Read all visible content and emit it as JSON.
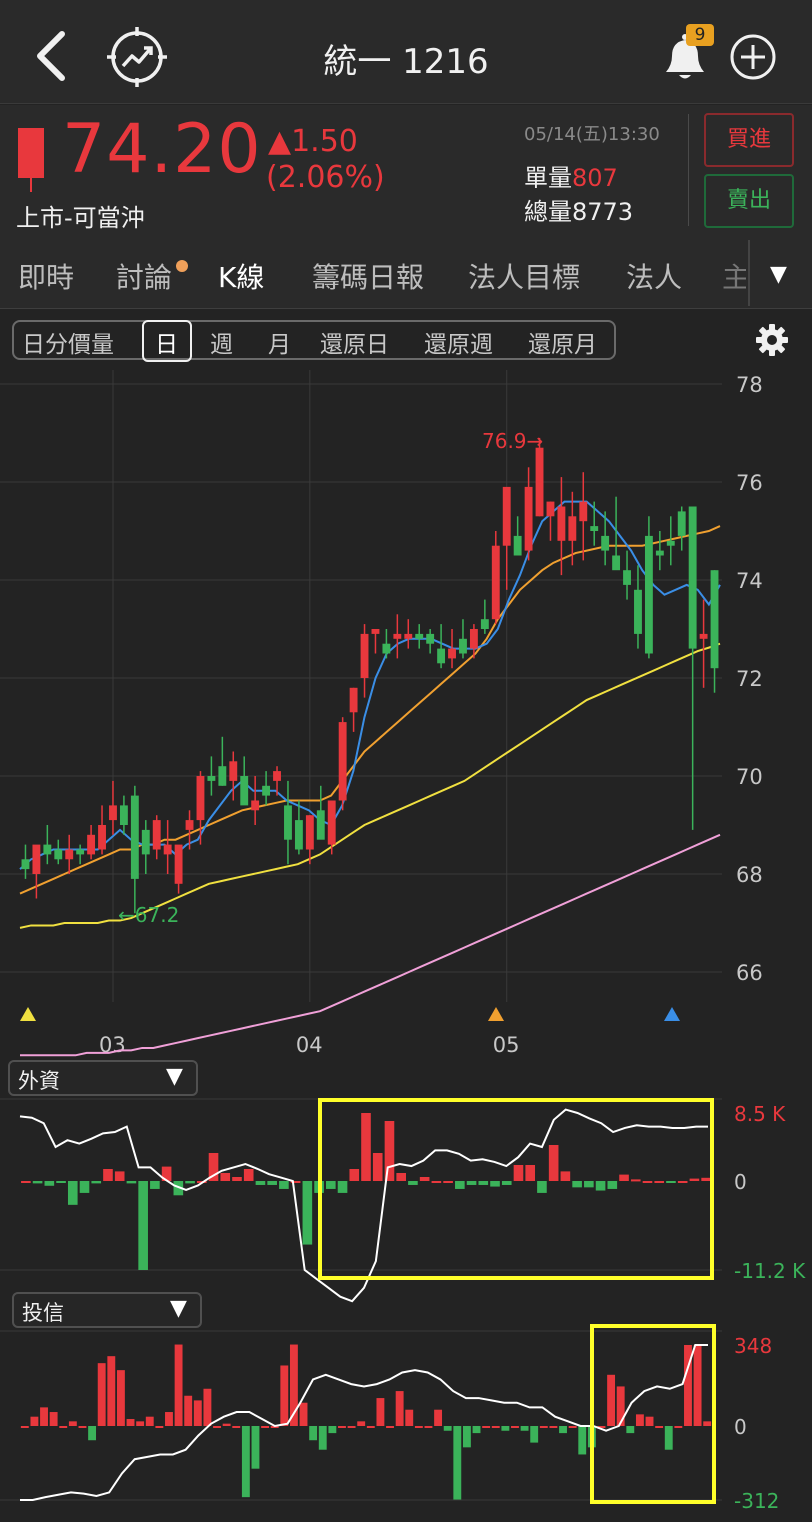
{
  "header": {
    "title": "統一 1216",
    "notification_count": "9",
    "back_icon": "chevron-left-icon",
    "trend_icon": "target-trend-icon",
    "bell_icon": "bell-icon",
    "add_icon": "plus-circle-icon"
  },
  "quote": {
    "price": "74.20",
    "change": "▲1.50",
    "change_pct": "(2.06%)",
    "market": "上市-可當沖",
    "datetime": "05/14(五)13:30",
    "single_vol_label": "單量",
    "single_vol": "807",
    "total_vol_label": "總量",
    "total_vol": "8773",
    "buy_label": "買進",
    "sell_label": "賣出"
  },
  "tabs": [
    "即時",
    "討論",
    "K線",
    "籌碼日報",
    "法人目標",
    "法人",
    "主"
  ],
  "active_tab": "K線",
  "periods": [
    "日分價量",
    "日",
    "週",
    "月",
    "還原日",
    "還原週",
    "還原月"
  ],
  "active_period": "日",
  "colors": {
    "up": "#e8383d",
    "down": "#3bb35a",
    "ma5": "#3a8ee6",
    "ma10": "#f0a030",
    "ma20": "#f0e040",
    "ma60": "#f0a0d8",
    "highlight": "#ffff2a"
  },
  "chart_data": [
    {
      "type": "candlestick",
      "yticks": [
        "78",
        "76",
        "74",
        "72",
        "70",
        "68",
        "66"
      ],
      "ylim": [
        65,
        79
      ],
      "xticks": [
        "03",
        "04",
        "05"
      ],
      "annotations": {
        "high": "76.9→",
        "low": "←67.2"
      },
      "ohlc": [
        [
          68.3,
          68.6,
          67.9,
          68.1
        ],
        [
          68.0,
          68.5,
          67.5,
          68.6
        ],
        [
          68.6,
          69.0,
          68.2,
          68.4
        ],
        [
          68.5,
          68.7,
          68.2,
          68.3
        ],
        [
          68.3,
          68.8,
          68.0,
          68.5
        ],
        [
          68.5,
          68.6,
          68.2,
          68.4
        ],
        [
          68.4,
          69.0,
          68.3,
          68.8
        ],
        [
          68.5,
          69.4,
          68.4,
          69.0
        ],
        [
          69.1,
          69.9,
          68.8,
          69.4
        ],
        [
          69.4,
          69.6,
          68.8,
          69.0
        ],
        [
          69.6,
          69.8,
          67.2,
          67.9
        ],
        [
          68.9,
          69.1,
          68.0,
          68.4
        ],
        [
          68.5,
          69.2,
          68.3,
          69.1
        ],
        [
          68.4,
          69.1,
          68.0,
          68.6
        ],
        [
          67.8,
          68.5,
          67.6,
          68.6
        ],
        [
          68.9,
          69.3,
          68.5,
          69.1
        ],
        [
          69.1,
          70.1,
          68.6,
          70.0
        ],
        [
          70.0,
          70.4,
          69.6,
          69.9
        ],
        [
          70.2,
          70.8,
          69.8,
          69.8
        ],
        [
          69.9,
          70.5,
          69.5,
          70.3
        ],
        [
          70.0,
          70.4,
          69.5,
          69.4
        ],
        [
          69.3,
          70.0,
          69.0,
          69.5
        ],
        [
          69.8,
          70.1,
          69.4,
          69.6
        ],
        [
          69.9,
          70.2,
          69.6,
          70.1
        ],
        [
          69.4,
          69.9,
          68.2,
          68.7
        ],
        [
          69.1,
          69.5,
          68.4,
          68.5
        ],
        [
          68.5,
          69.2,
          68.2,
          69.2
        ],
        [
          69.3,
          69.8,
          68.8,
          68.7
        ],
        [
          68.6,
          69.3,
          68.4,
          69.5
        ],
        [
          69.5,
          71.2,
          69.3,
          71.1
        ],
        [
          71.3,
          71.8,
          70.9,
          71.8
        ],
        [
          72.0,
          73.1,
          71.6,
          72.9
        ],
        [
          72.9,
          73.0,
          72.5,
          73.0
        ],
        [
          72.7,
          73.0,
          72.4,
          72.5
        ],
        [
          72.8,
          73.3,
          72.4,
          72.9
        ],
        [
          72.8,
          73.2,
          72.6,
          72.9
        ],
        [
          72.9,
          73.1,
          72.6,
          72.8
        ],
        [
          72.9,
          73.0,
          72.5,
          72.7
        ],
        [
          72.6,
          73.1,
          72.2,
          72.3
        ],
        [
          72.4,
          73.0,
          72.2,
          72.6
        ],
        [
          72.8,
          73.2,
          72.4,
          72.5
        ],
        [
          72.6,
          73.1,
          72.4,
          73.0
        ],
        [
          73.2,
          73.6,
          72.9,
          73.0
        ],
        [
          73.2,
          75.0,
          73.1,
          74.7
        ],
        [
          74.7,
          75.8,
          73.8,
          75.9
        ],
        [
          74.9,
          75.3,
          74.5,
          74.5
        ],
        [
          74.6,
          76.3,
          74.4,
          75.9
        ],
        [
          75.3,
          76.9,
          75.3,
          76.7
        ],
        [
          75.3,
          75.6,
          74.8,
          75.6
        ],
        [
          74.8,
          76.1,
          74.1,
          75.5
        ],
        [
          74.8,
          75.8,
          74.3,
          75.3
        ],
        [
          75.2,
          76.2,
          74.4,
          75.6
        ],
        [
          75.1,
          75.6,
          74.7,
          75.0
        ],
        [
          74.9,
          75.4,
          74.3,
          74.6
        ],
        [
          74.5,
          75.7,
          74.3,
          74.2
        ],
        [
          74.2,
          74.6,
          73.6,
          73.9
        ],
        [
          73.8,
          74.3,
          72.6,
          72.9
        ],
        [
          74.9,
          75.3,
          72.4,
          72.5
        ],
        [
          74.6,
          75.0,
          74.2,
          74.5
        ],
        [
          74.8,
          75.3,
          74.3,
          74.7
        ],
        [
          75.4,
          75.5,
          74.6,
          74.9
        ],
        [
          75.5,
          75.5,
          68.9,
          72.6
        ],
        [
          72.8,
          73.6,
          71.8,
          72.9
        ],
        [
          74.2,
          74.2,
          71.7,
          72.2
        ]
      ],
      "ma5": [
        68.1,
        68.3,
        68.4,
        68.5,
        68.5,
        68.5,
        68.5,
        68.5,
        68.7,
        68.9,
        68.7,
        68.6,
        68.6,
        68.6,
        68.4,
        68.6,
        68.7,
        69.1,
        69.4,
        69.7,
        69.9,
        69.7,
        69.7,
        69.7,
        69.5,
        69.4,
        69.3,
        69.1,
        69.0,
        69.4,
        70.1,
        71.2,
        72.0,
        72.5,
        72.7,
        72.8,
        72.8,
        72.8,
        72.7,
        72.6,
        72.6,
        72.6,
        72.7,
        73.0,
        73.6,
        74.1,
        74.7,
        75.2,
        75.4,
        75.6,
        75.6,
        75.6,
        75.4,
        75.2,
        74.9,
        74.6,
        74.2,
        73.9,
        73.7,
        73.8,
        73.9,
        73.8,
        73.5,
        73.9
      ],
      "ma10": [
        67.6,
        67.7,
        67.8,
        67.9,
        68.0,
        68.1,
        68.2,
        68.3,
        68.4,
        68.5,
        68.5,
        68.6,
        68.6,
        68.7,
        68.7,
        68.8,
        68.9,
        69.0,
        69.1,
        69.2,
        69.3,
        69.35,
        69.4,
        69.45,
        69.5,
        69.5,
        69.5,
        69.5,
        69.6,
        69.9,
        70.2,
        70.5,
        70.7,
        70.9,
        71.1,
        71.3,
        71.5,
        71.7,
        71.9,
        72.1,
        72.3,
        72.5,
        72.8,
        73.2,
        73.5,
        73.8,
        74.0,
        74.2,
        74.35,
        74.45,
        74.55,
        74.6,
        74.65,
        74.7,
        74.7,
        74.7,
        74.7,
        74.75,
        74.8,
        74.85,
        74.9,
        74.95,
        75.0,
        75.1
      ],
      "ma20": [
        66.9,
        66.95,
        66.95,
        66.95,
        67.0,
        67.0,
        67.0,
        67.0,
        67.05,
        67.05,
        67.1,
        67.2,
        67.3,
        67.4,
        67.5,
        67.6,
        67.7,
        67.8,
        67.85,
        67.9,
        67.95,
        68.0,
        68.05,
        68.1,
        68.15,
        68.2,
        68.3,
        68.4,
        68.55,
        68.7,
        68.85,
        69.0,
        69.1,
        69.2,
        69.3,
        69.4,
        69.5,
        69.6,
        69.7,
        69.8,
        69.9,
        70.05,
        70.2,
        70.35,
        70.5,
        70.65,
        70.8,
        70.95,
        71.1,
        71.25,
        71.4,
        71.55,
        71.65,
        71.75,
        71.85,
        71.95,
        72.05,
        72.15,
        72.25,
        72.35,
        72.45,
        72.55,
        72.62,
        72.7
      ],
      "ma60": [
        64.3,
        64.3,
        64.3,
        64.3,
        64.3,
        64.3,
        64.35,
        64.35,
        64.35,
        64.4,
        64.4,
        64.45,
        64.45,
        64.5,
        64.55,
        64.6,
        64.65,
        64.7,
        64.75,
        64.8,
        64.85,
        64.9,
        64.95,
        65.0,
        65.05,
        65.1,
        65.15,
        65.2,
        65.3,
        65.4,
        65.5,
        65.6,
        65.7,
        65.8,
        65.9,
        66.0,
        66.1,
        66.2,
        66.3,
        66.4,
        66.5,
        66.6,
        66.7,
        66.8,
        66.9,
        67.0,
        67.1,
        67.2,
        67.3,
        67.4,
        67.5,
        67.6,
        67.7,
        67.8,
        67.9,
        68.0,
        68.1,
        68.2,
        68.3,
        68.4,
        68.5,
        68.6,
        68.7,
        68.8
      ],
      "markers": [
        {
          "candle": 0,
          "color": "#f0e040"
        },
        {
          "candle": 40,
          "color": "#f0a030"
        },
        {
          "candle": 55,
          "color": "#3a8ee6"
        }
      ]
    },
    {
      "type": "bar",
      "name": "外資",
      "yticks": [
        "8.5 K",
        "0",
        "-11.2 K"
      ],
      "ylim": [
        -11.2,
        8.5
      ],
      "values": [
        0.0,
        -0.3,
        -0.6,
        -0.1,
        -3.0,
        -1.5,
        -0.3,
        1.5,
        1.2,
        -0.3,
        -11.2,
        -1.0,
        1.8,
        -1.8,
        -0.3,
        0.0,
        3.5,
        1.0,
        0.5,
        1.5,
        -0.5,
        -0.5,
        -1.0,
        0.0,
        -8.0,
        -1.5,
        -1.0,
        -1.5,
        1.5,
        8.5,
        3.5,
        7.5,
        1.0,
        -0.5,
        0.5,
        0.0,
        0.0,
        -1.0,
        -0.5,
        -0.5,
        -0.7,
        -0.5,
        2.0,
        2.0,
        -1.5,
        4.5,
        1.2,
        -0.8,
        -0.8,
        -1.2,
        -1.0,
        0.8,
        0.2,
        0.0,
        0.0,
        -0.2,
        0.0,
        0.3,
        0.4
      ],
      "line": [
        0.95,
        0.93,
        0.85,
        0.5,
        0.6,
        0.55,
        0.62,
        0.7,
        0.72,
        0.8,
        0.2,
        0.2,
        0.05,
        -0.05,
        -0.1,
        -0.05,
        0.05,
        0.15,
        0.2,
        0.25,
        0.18,
        0.1,
        0.05,
        0.0,
        -1.0,
        -1.1,
        -1.2,
        -1.3,
        -1.35,
        -1.2,
        -0.9,
        0.2,
        0.25,
        0.22,
        0.3,
        0.45,
        0.45,
        0.4,
        0.3,
        0.32,
        0.28,
        0.22,
        0.35,
        0.55,
        0.5,
        0.9,
        1.05,
        1.0,
        0.92,
        0.85,
        0.72,
        0.78,
        0.82,
        0.8,
        0.8,
        0.78,
        0.78,
        0.8,
        0.8
      ]
    },
    {
      "type": "bar",
      "name": "投信",
      "yticks": [
        "348",
        "0",
        "-312"
      ],
      "ylim": [
        -312,
        348
      ],
      "values": [
        0,
        40,
        80,
        60,
        0,
        20,
        0,
        -60,
        270,
        300,
        240,
        30,
        20,
        40,
        0,
        60,
        350,
        130,
        110,
        160,
        0,
        10,
        0,
        -300,
        -180,
        0,
        0,
        260,
        350,
        100,
        -60,
        -100,
        -30,
        0,
        0,
        20,
        0,
        120,
        0,
        150,
        70,
        0,
        0,
        70,
        -20,
        -310,
        -90,
        -30,
        0,
        0,
        -20,
        0,
        -20,
        -70,
        0,
        0,
        -30,
        0,
        -120,
        -90,
        0,
        220,
        170,
        -30,
        50,
        40,
        0,
        -100,
        0,
        348,
        348,
        20
      ],
      "line": [
        -312,
        -312,
        -300,
        -290,
        -280,
        -285,
        -295,
        -280,
        -200,
        -140,
        -130,
        -120,
        -120,
        -100,
        -40,
        10,
        40,
        60,
        60,
        30,
        0,
        10,
        100,
        200,
        220,
        200,
        180,
        170,
        180,
        200,
        230,
        240,
        230,
        200,
        150,
        120,
        120,
        110,
        100,
        100,
        80,
        80,
        40,
        20,
        0,
        0,
        -20,
        0,
        100,
        150,
        170,
        160,
        180,
        348,
        348
      ]
    }
  ],
  "indicators": {
    "selector1_label": "外資",
    "selector2_label": "投信",
    "dropdown_arrow": "▼"
  },
  "more_arrow": "▼"
}
